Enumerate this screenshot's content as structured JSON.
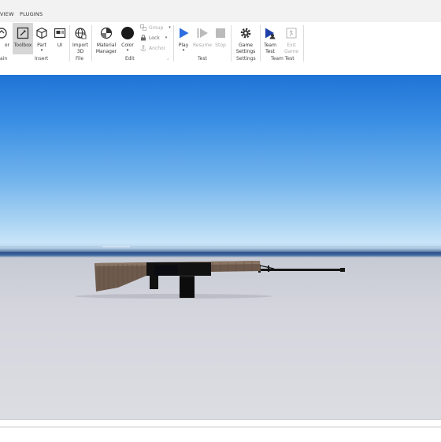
{
  "menu": {
    "items": [
      "VIEW",
      "PLUGINS"
    ]
  },
  "ribbon": {
    "tools": {
      "editor_label": "or",
      "toolbox_label": "Toolbox",
      "part_label": "Part",
      "ui_label": "UI",
      "import3d_label_1": "Import",
      "import3d_label_2": "3D",
      "material_label_1": "Material",
      "material_label_2": "Manager",
      "color_label": "Color",
      "group_label": "Group",
      "lock_label": "Lock",
      "anchor_label": "Anchor",
      "play_label": "Play",
      "resume_label": "Resume",
      "stop_label": "Stop",
      "game_settings_label_1": "Game",
      "game_settings_label_2": "Settings",
      "team_test_label_1": "Team",
      "team_test_label_2": "Test",
      "exit_game_label_1": "Exit",
      "exit_game_label_2": "Game"
    },
    "groups": {
      "terrain": "ain",
      "insert": "Insert",
      "file": "File",
      "edit": "Edit",
      "test": "Test",
      "settings": "Settings",
      "team_test": "Team Test"
    }
  },
  "viewport": {
    "object": "rifle-model"
  },
  "colors": {
    "play": "#2f6de1",
    "team_test": "#1f3fa8",
    "stock": "#6e5a4c",
    "metal": "#151515"
  }
}
